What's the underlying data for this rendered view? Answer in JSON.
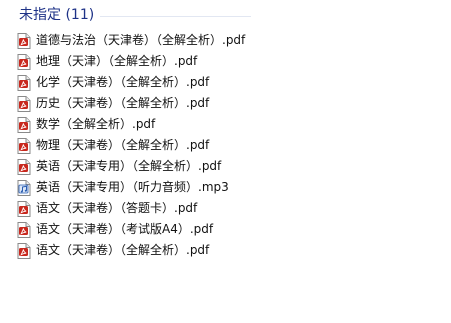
{
  "group": {
    "title": "未指定 (11)"
  },
  "files": [
    {
      "name": "道德与法治（天津卷）（全解全析）.pdf",
      "icon": "pdf-file-icon"
    },
    {
      "name": "地理（天津）（全解全析）.pdf",
      "icon": "pdf-file-icon"
    },
    {
      "name": "化学（天津卷）（全解全析）.pdf",
      "icon": "pdf-file-icon"
    },
    {
      "name": "历史（天津卷）（全解全析）.pdf",
      "icon": "pdf-file-icon"
    },
    {
      "name": "数学（全解全析）.pdf",
      "icon": "pdf-file-icon"
    },
    {
      "name": "物理（天津卷）（全解全析）.pdf",
      "icon": "pdf-file-icon"
    },
    {
      "name": "英语（天津专用）（全解全析）.pdf",
      "icon": "pdf-file-icon"
    },
    {
      "name": "英语（天津专用）（听力音频）.mp3",
      "icon": "mp3-file-icon"
    },
    {
      "name": "语文（天津卷）（答题卡）.pdf",
      "icon": "pdf-file-icon"
    },
    {
      "name": "语文（天津卷）（考试版A4）.pdf",
      "icon": "pdf-file-icon"
    },
    {
      "name": "语文（天津卷）（全解全析）.pdf",
      "icon": "pdf-file-icon"
    }
  ],
  "colors": {
    "group_title": "#1e3287",
    "pdf_accent": "#c8281e",
    "mp3_accent": "#2a5db0"
  }
}
